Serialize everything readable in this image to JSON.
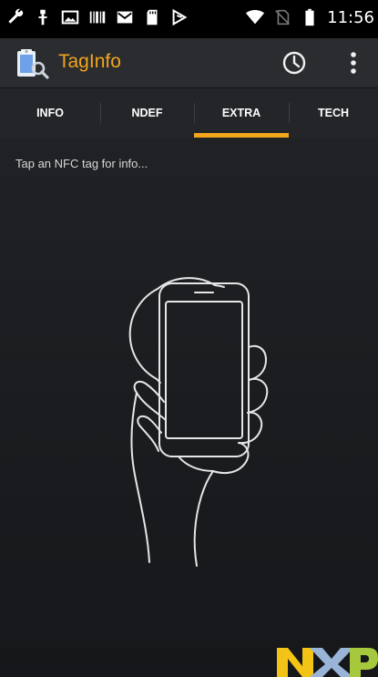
{
  "status_bar": {
    "time": "11:56",
    "left_icons": [
      "wrench-icon",
      "usb-debug-icon",
      "image-icon",
      "barcode-icon",
      "mail-icon",
      "sd-card-icon",
      "android-debug-icon"
    ],
    "right_icons": [
      "wifi-icon",
      "no-sim-icon",
      "battery-icon"
    ]
  },
  "action_bar": {
    "title": "TagInfo",
    "icon": "taginfo-app-icon",
    "actions": [
      "history-icon",
      "overflow-menu-icon"
    ],
    "title_color": "#f3a51c"
  },
  "tabs": [
    {
      "label": "INFO",
      "selected": false
    },
    {
      "label": "NDEF",
      "selected": false
    },
    {
      "label": "EXTRA",
      "selected": true
    },
    {
      "label": "TECH",
      "selected": false
    }
  ],
  "main": {
    "hint": "Tap an NFC tag for info...",
    "illustration": "hand-holding-phone-over-tag"
  },
  "footer": {
    "logo": "NXP",
    "logo_colors": [
      "#f3c315",
      "#9ab4d8",
      "#a6c83c"
    ]
  },
  "colors": {
    "accent": "#f3a51c",
    "background": "#1e2023"
  }
}
